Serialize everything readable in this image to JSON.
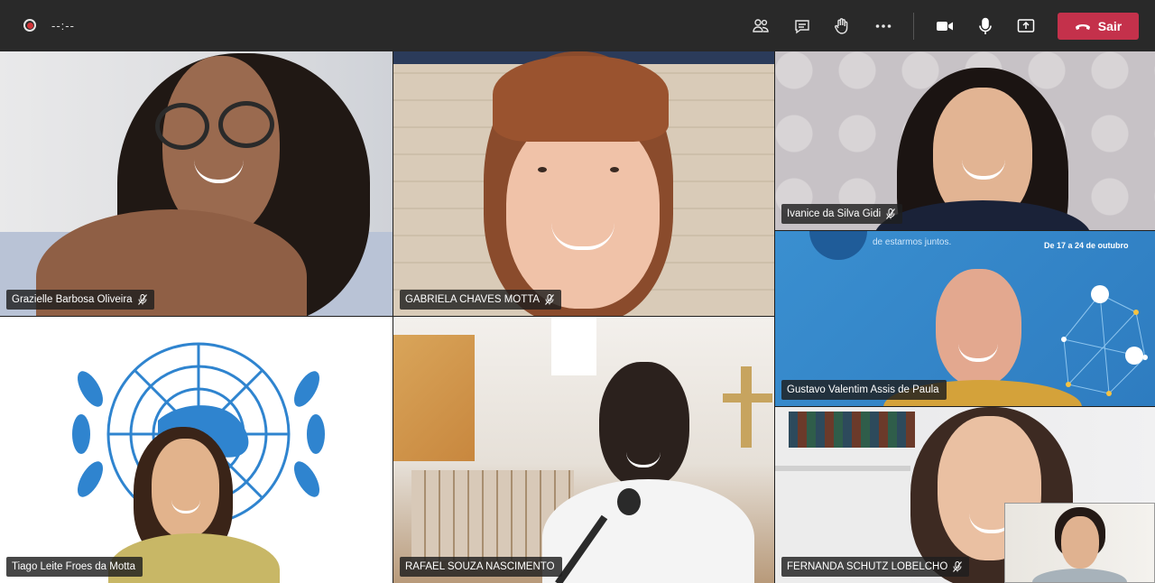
{
  "toolbar": {
    "recording_timer": "--:--",
    "leave_label": "Sair",
    "icons": [
      "participants-icon",
      "chat-icon",
      "raise-hand-icon",
      "more-options-icon",
      "camera-icon",
      "microphone-icon",
      "share-screen-icon",
      "hang-up-icon"
    ],
    "leave_color": "#c4314b"
  },
  "participants": [
    {
      "name": "Grazielle Barbosa Oliveira",
      "muted": true
    },
    {
      "name": "GABRIELA CHAVES MOTTA",
      "muted": true
    },
    {
      "name": "Ivanice da Silva Gidi",
      "muted": true
    },
    {
      "name": "Gustavo Valentim Assis de Paula",
      "muted": false
    },
    {
      "name": "Tiago Leite Froes da Motta",
      "muted": false
    },
    {
      "name": "RAFAEL SOUZA NASCIMENTO",
      "muted": false
    },
    {
      "name": "FERNANDA SCHUTZ LOBELCHO",
      "muted": true
    }
  ],
  "background_text": {
    "banner_line": "de estarmos juntos.",
    "date_range": "De 17 a 24 de outubro"
  }
}
